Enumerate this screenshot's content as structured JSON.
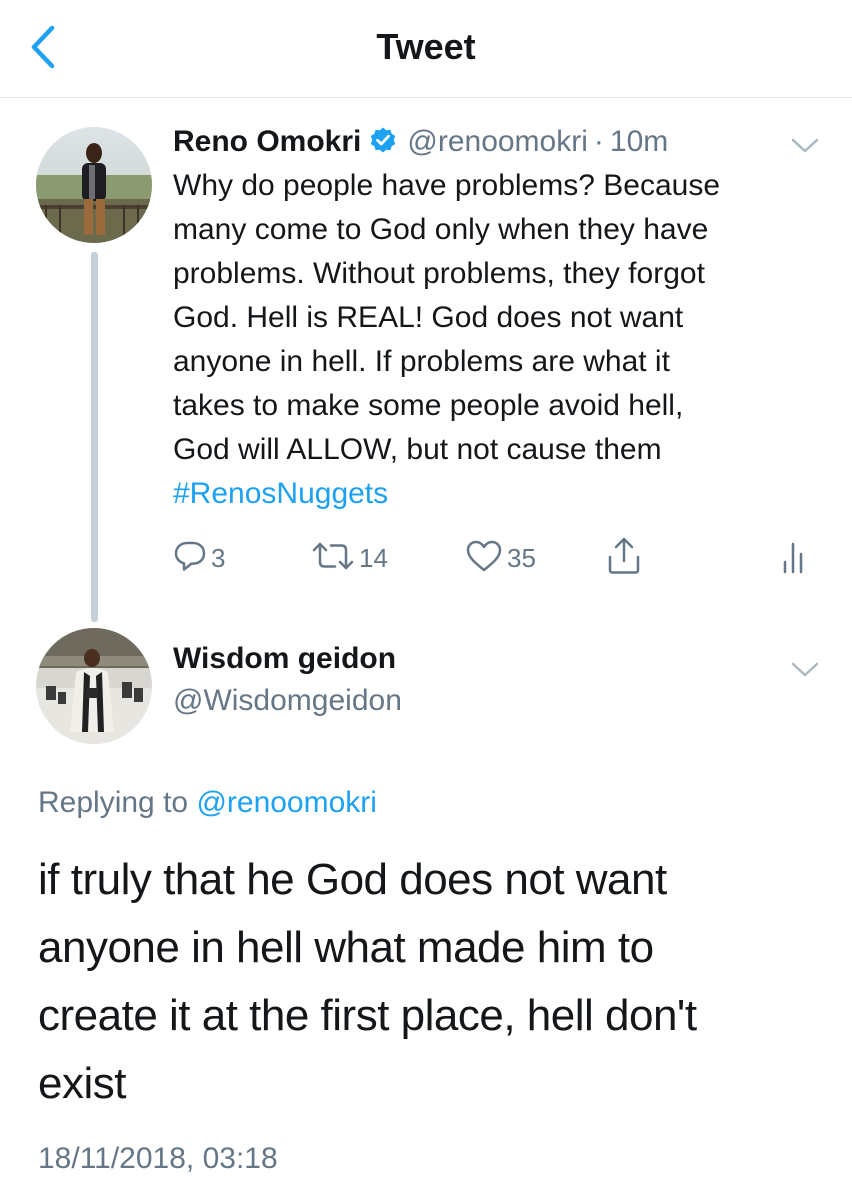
{
  "header": {
    "title": "Tweet",
    "back_icon": "chevron-left-icon"
  },
  "colors": {
    "accent": "#1da1f2",
    "text": "#14171a",
    "secondary": "#657786",
    "divider": "#e1e8ed"
  },
  "tweet": {
    "author_name": "Reno Omokri",
    "verified": true,
    "handle": "@renoomokri",
    "time_separator": "·",
    "time": "10m",
    "text_lines": [
      "Why do people have problems? Because",
      "many come to God only when they have",
      "problems. Without problems, they forgot",
      "God. Hell is REAL! God does not want",
      "anyone in hell. If problems are what it",
      "takes to make some people avoid hell,",
      "God will ALLOW, but not cause them"
    ],
    "hashtag": "#RenosNuggets",
    "actions": {
      "replies": "3",
      "retweets": "14",
      "likes": "35"
    }
  },
  "reply": {
    "author_name": "Wisdom geidon",
    "handle": "@Wisdomgeidon",
    "replying_prefix": "Replying to",
    "replying_to": "@renoomokri",
    "text_lines": [
      "if truly that he God does not want",
      "anyone in hell what made him to",
      "create it at the first place, hell don't",
      "exist"
    ],
    "timestamp": "18/11/2018, 03:18"
  }
}
